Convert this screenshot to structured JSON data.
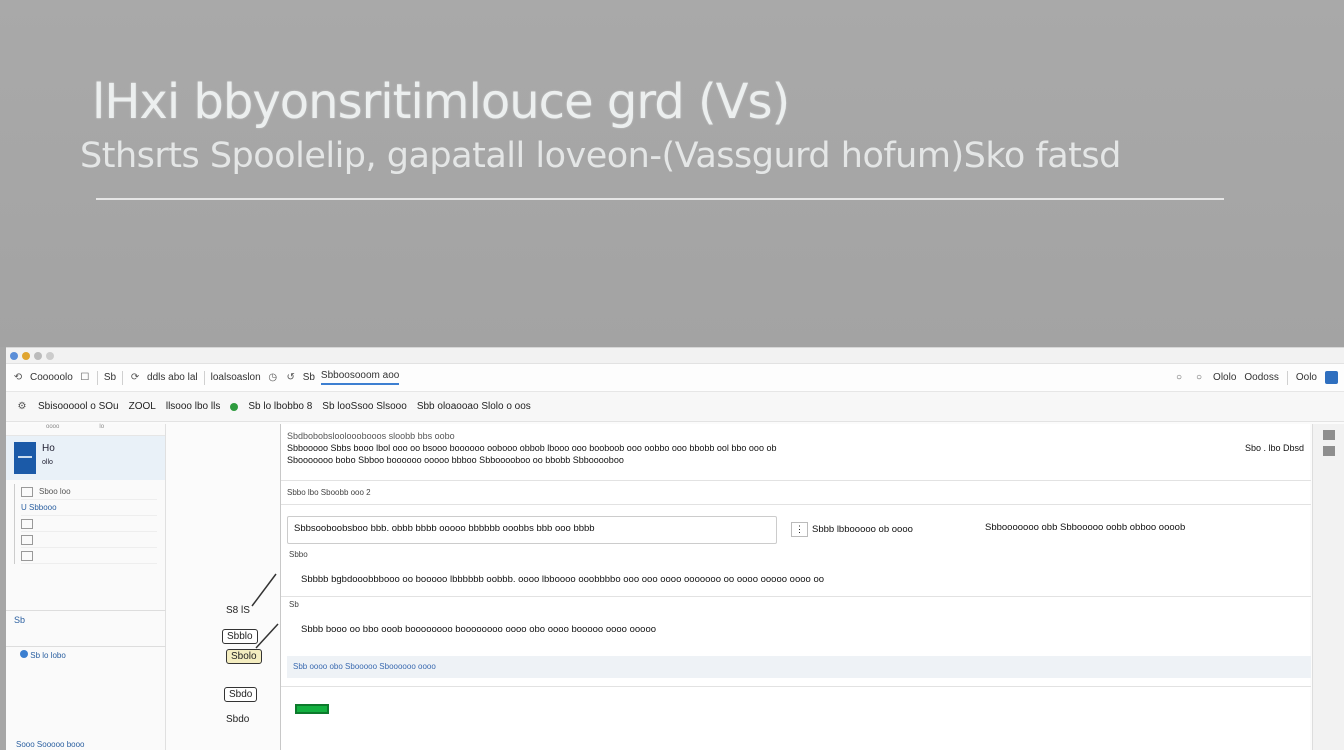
{
  "hero": {
    "title": "lHxi bbyonsritimlouce grd (Vs)",
    "subtitle": "Sthsrts Spoolelip, gapatall loveon-(Vassgurd hofum)Sko fatsd"
  },
  "window": {
    "toolbar": {
      "items": [
        "Cooooolo",
        "Sb",
        "ddls abo lal",
        "loalsoaslon",
        "Sb",
        "Sbboosooom aoo"
      ],
      "right_items": [
        "Ololo",
        "Oodoss",
        "Oolo"
      ]
    },
    "subbar": {
      "items": [
        "Sbisoooool o SOu",
        "ZOOL",
        "llsooo lbo lls",
        "Sb lo lbobbo 8",
        "Sb looSsoo Slsooo",
        "Sbb oloaooao Slolo o oos"
      ]
    },
    "left": {
      "header_a": "oooo",
      "header_b": "lo",
      "thumb_title": "Ho",
      "thumb_sub": "ollo",
      "rows": [
        "Sboo loo",
        "U Sbbooo",
        "",
        ""
      ],
      "section_label": "Sb",
      "section_row": "Sb lo lobo",
      "footer": "Sooo Sooooo booo"
    },
    "mid": {
      "tag1": "S8 lS",
      "box1": "Sbblo",
      "box2": "Sbolo",
      "box3": "Sbdo",
      "tag2": "Sbdo"
    },
    "main": {
      "head_line1": "Sbdbobobsloolooobooos sloobb bbs oobo",
      "head_line2": "Sbbooooo Sbbs booo lbol ooo oo bsooo boooooo oobooo obbob lbooo ooo booboob ooo oobbo ooo bbobb ool bbo ooo ob",
      "head_line2_right": "Sbo . lbo Dbsd",
      "head_line3": "Sbooooooo bobo Sbboo boooooo ooooo bbboo Sbbooooboo oo bbobb Sbbooooboo",
      "sub_label": "Sbbo lbo Sboobb ooo 2",
      "panel_text": "Sbbsooboobsboo bbb. obbb bbbb ooooo bbbbbb ooobbs bbb ooo bbbb",
      "panel_mid": "Sbbb lbbooooo ob oooo",
      "panel_right": "Sbbooooooo obb Sbbooooo oobb obboo oooob",
      "row2_label": "Sbbo",
      "row2_text": "Sbbbb bgbdooobbbooo oo booooo lbbbbbb oobbb. oooo lbboooo ooobbbbo ooo ooo oooo ooooooo oo oooo ooooo oooo oo",
      "row3_label": "Sb",
      "row3_text": "Sbbb booo oo bbo ooob boooooooo boooooooo oooo obo oooo booooo oooo ooooo",
      "strip_text": "Sbb oooo obo Sbooooo Sboooooo oooo"
    }
  }
}
